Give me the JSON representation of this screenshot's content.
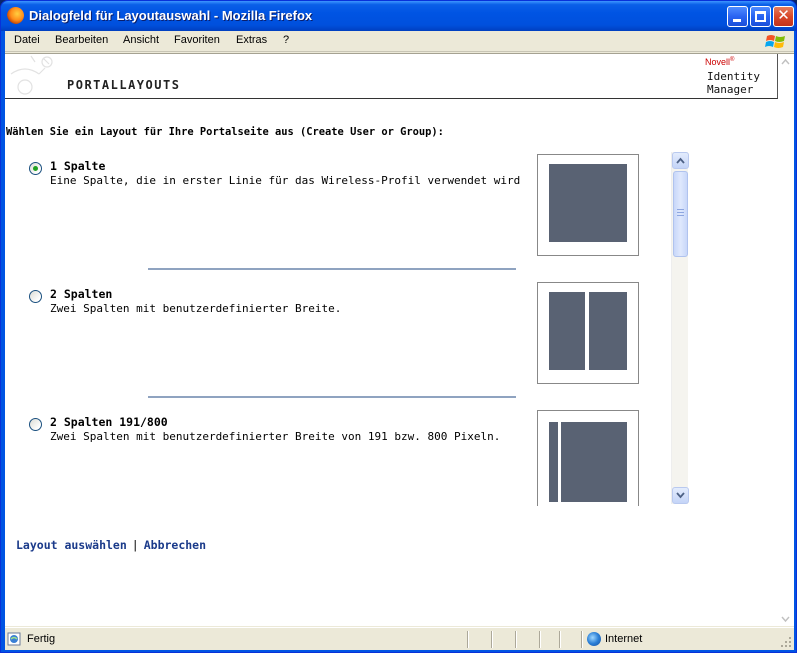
{
  "window": {
    "title": "Dialogfeld für Layoutauswahl - Mozilla Firefox"
  },
  "menu": [
    "Datei",
    "Bearbeiten",
    "Ansicht",
    "Favoriten",
    "Extras",
    "?"
  ],
  "header": {
    "title": "PORTALLAYOUTS",
    "brand": "Novell",
    "product_line1": "Identity",
    "product_line2": "Manager"
  },
  "intro": "Wählen Sie ein Layout für Ihre Portalseite aus (Create User or Group):",
  "layouts": [
    {
      "title": "1 Spalte",
      "description": "Eine Spalte, die in erster Linie für das Wireless-Profil verwendet wird",
      "selected": true
    },
    {
      "title": "2 Spalten",
      "description": "Zwei Spalten mit benutzerdefinierter Breite.",
      "selected": false
    },
    {
      "title": "2 Spalten 191/800",
      "description": "Zwei Spalten mit benutzerdefinierter Breite von 191 bzw. 800 Pixeln.",
      "selected": false
    }
  ],
  "actions": {
    "select": "Layout auswählen",
    "separator": "|",
    "cancel": "Abbrechen"
  },
  "status": {
    "text": "Fertig",
    "zone": "Internet"
  },
  "colors": {
    "titlebar": "#0054e3",
    "thumbnail_block": "#596273",
    "link": "#1a3a8a",
    "separator": "#8fa3c0",
    "radio_checked": "#21a121"
  }
}
